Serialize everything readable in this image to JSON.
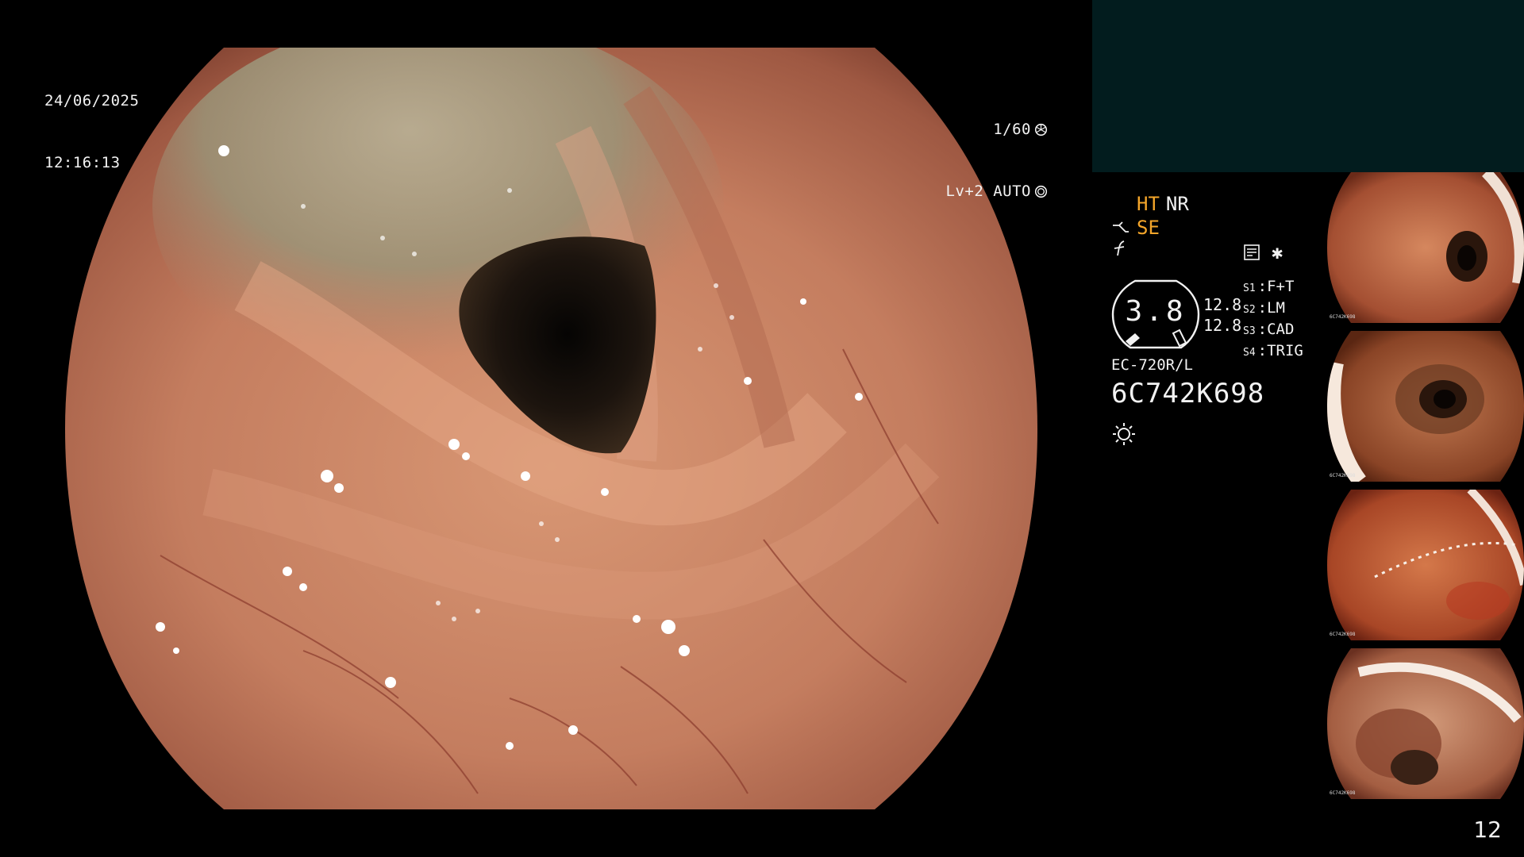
{
  "overlay": {
    "date": "24/06/2025",
    "time": "12:16:13",
    "shutter": "1/60",
    "exposure": "Lv+2 AUTO"
  },
  "settings": {
    "ht": "HT",
    "nr": "NR",
    "se": "SE",
    "gauge_value": "3.8",
    "zoom_1": "12.8",
    "zoom_2": "12.8",
    "modes": [
      {
        "key": "S1",
        "label": "F+T"
      },
      {
        "key": "S2",
        "label": "LM"
      },
      {
        "key": "S3",
        "label": "CAD"
      },
      {
        "key": "S4",
        "label": "TRIG"
      }
    ],
    "scope_model": "EC-720R/L",
    "serial": "6C742K698"
  },
  "thumbnails": [
    {
      "name": "thumb-1",
      "caption": "6C742K698"
    },
    {
      "name": "thumb-2",
      "caption": "6C742K698"
    },
    {
      "name": "thumb-3",
      "caption": "6C742K698"
    },
    {
      "name": "thumb-4",
      "caption": "6C742K698"
    }
  ],
  "page_number": "12",
  "colors": {
    "accent_orange": "#f5a62a",
    "panel_teal": "#021c1e",
    "tissue": "#c8866a"
  },
  "icons": [
    "aperture-icon",
    "auto-iris-icon",
    "scope-angle-icon",
    "flash-icon",
    "memory-icon",
    "asterisk-icon",
    "brightness-icon"
  ]
}
